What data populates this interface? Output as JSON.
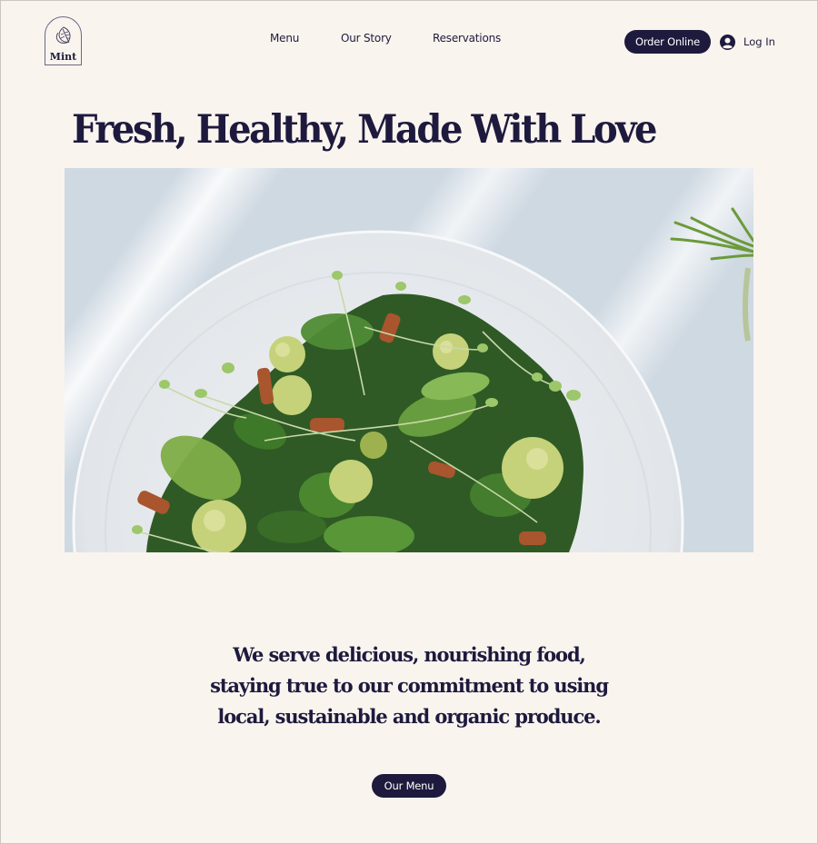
{
  "brand": {
    "name": "Mint",
    "logo_icon": "leaf-icon"
  },
  "nav": {
    "items": [
      {
        "label": "Menu"
      },
      {
        "label": "Our Story"
      },
      {
        "label": "Reservations"
      }
    ]
  },
  "header_actions": {
    "order_online_label": "Order Online",
    "login_label": "Log In",
    "login_icon": "user-avatar-icon"
  },
  "hero": {
    "title": "Fresh, Healthy, Made With Love",
    "image_alt": "Salad with microgreens, romanesco and spinach on a white plate"
  },
  "intro": {
    "lines": [
      "We serve delicious, nourishing food,",
      "staying true to our commitment to using",
      "local, sustainable and organic produce."
    ],
    "cta_label": "Our Menu"
  },
  "colors": {
    "background": "#faf4ef",
    "primary": "#1e1a3d",
    "button_text": "#ffffff"
  }
}
